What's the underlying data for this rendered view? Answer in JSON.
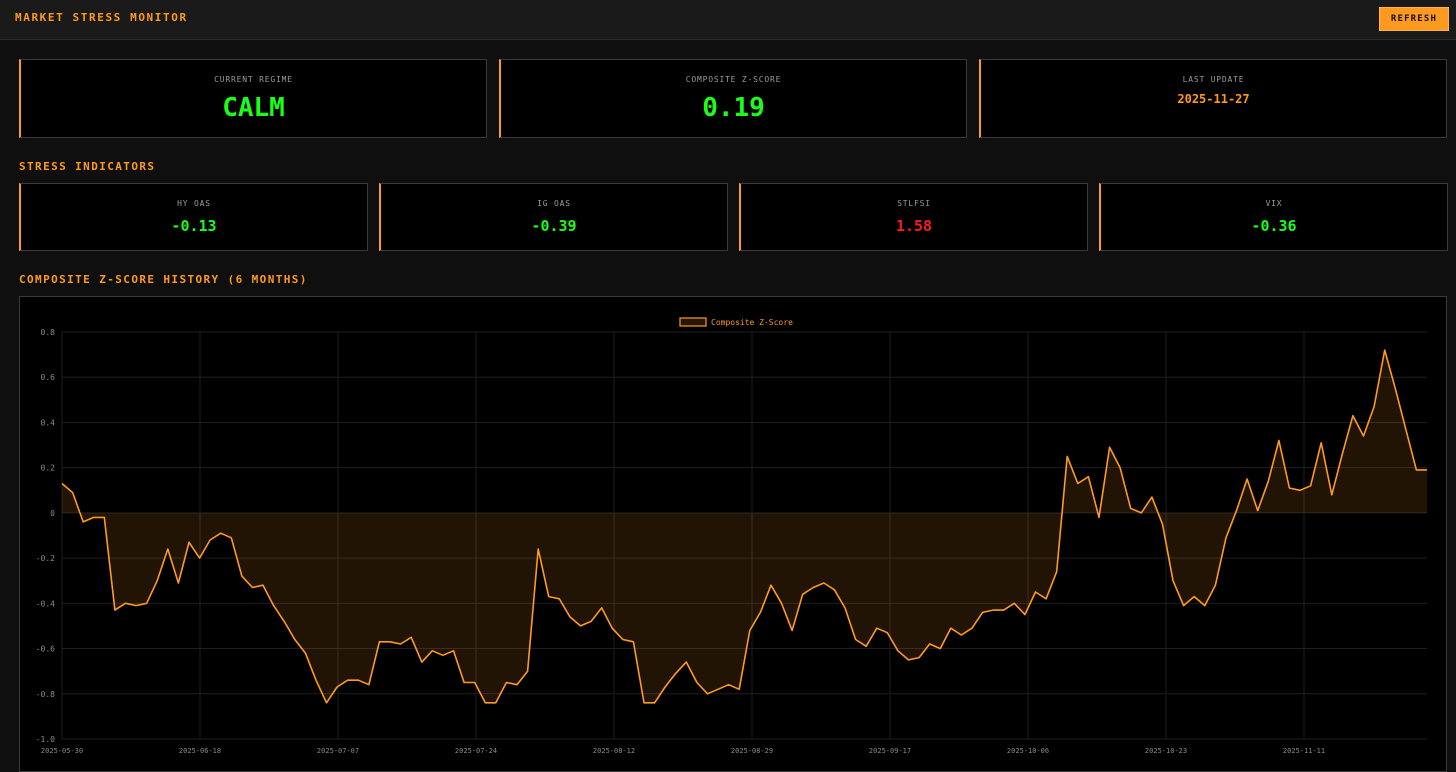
{
  "header": {
    "title": "MARKET STRESS MONITOR",
    "refresh_label": "REFRESH"
  },
  "summary": {
    "regime_label": "CURRENT REGIME",
    "regime_value": "CALM",
    "zscore_label": "COMPOSITE Z-SCORE",
    "zscore_value": "0.19",
    "update_label": "LAST UPDATE",
    "update_value": "2025-11-27"
  },
  "indicators": {
    "title": "STRESS INDICATORS",
    "items": [
      {
        "label": "HY OAS",
        "value": "-0.13",
        "status": "green"
      },
      {
        "label": "IG OAS",
        "value": "-0.39",
        "status": "green"
      },
      {
        "label": "STLFSI",
        "value": "1.58",
        "status": "red"
      },
      {
        "label": "VIX",
        "value": "-0.36",
        "status": "green"
      }
    ]
  },
  "colors": {
    "accent": "#ff9a1f",
    "positive": "#18ff18",
    "negative": "#ff1a1a"
  },
  "history": {
    "title": "COMPOSITE Z-SCORE HISTORY (6 MONTHS)"
  },
  "chart_data": {
    "type": "area",
    "legend": "Composite Z-Score",
    "legend_position": "top-center",
    "ylim": [
      -1.0,
      0.8
    ],
    "y_ticks": [
      "0.8",
      "0.6",
      "0.4",
      "0.2",
      "0",
      "-0.2",
      "-0.4",
      "-0.6",
      "-0.8",
      "-1.0"
    ],
    "x_ticks": [
      "2025-05-30",
      "2025-06-18",
      "2025-07-07",
      "2025-07-24",
      "2025-08-12",
      "2025-08-29",
      "2025-09-17",
      "2025-10-06",
      "2025-10-23",
      "2025-11-11"
    ],
    "grid": true,
    "series": [
      {
        "name": "Composite Z-Score",
        "values": [
          0.13,
          0.09,
          -0.04,
          -0.02,
          -0.02,
          -0.43,
          -0.4,
          -0.41,
          -0.4,
          -0.3,
          -0.16,
          -0.31,
          -0.13,
          -0.2,
          -0.12,
          -0.09,
          -0.11,
          -0.28,
          -0.33,
          -0.32,
          -0.41,
          -0.48,
          -0.56,
          -0.62,
          -0.74,
          -0.84,
          -0.77,
          -0.74,
          -0.74,
          -0.76,
          -0.57,
          -0.57,
          -0.58,
          -0.55,
          -0.66,
          -0.61,
          -0.63,
          -0.61,
          -0.75,
          -0.75,
          -0.84,
          -0.84,
          -0.75,
          -0.76,
          -0.7,
          -0.16,
          -0.37,
          -0.38,
          -0.46,
          -0.5,
          -0.48,
          -0.42,
          -0.51,
          -0.56,
          -0.57,
          -0.84,
          -0.84,
          -0.77,
          -0.71,
          -0.66,
          -0.75,
          -0.8,
          -0.78,
          -0.76,
          -0.78,
          -0.52,
          -0.44,
          -0.32,
          -0.4,
          -0.52,
          -0.36,
          -0.33,
          -0.31,
          -0.34,
          -0.42,
          -0.56,
          -0.59,
          -0.51,
          -0.53,
          -0.61,
          -0.65,
          -0.64,
          -0.58,
          -0.6,
          -0.51,
          -0.54,
          -0.51,
          -0.44,
          -0.43,
          -0.43,
          -0.4,
          -0.45,
          -0.35,
          -0.38,
          -0.26,
          0.25,
          0.13,
          0.16,
          -0.02,
          0.29,
          0.2,
          0.02,
          0.0,
          0.07,
          -0.05,
          -0.3,
          -0.41,
          -0.37,
          -0.41,
          -0.32,
          -0.11,
          0.01,
          0.15,
          0.01,
          0.14,
          0.32,
          0.11,
          0.1,
          0.12,
          0.31,
          0.08,
          0.26,
          0.43,
          0.34,
          0.47,
          0.72,
          0.55,
          0.37,
          0.19,
          0.19
        ]
      }
    ]
  }
}
